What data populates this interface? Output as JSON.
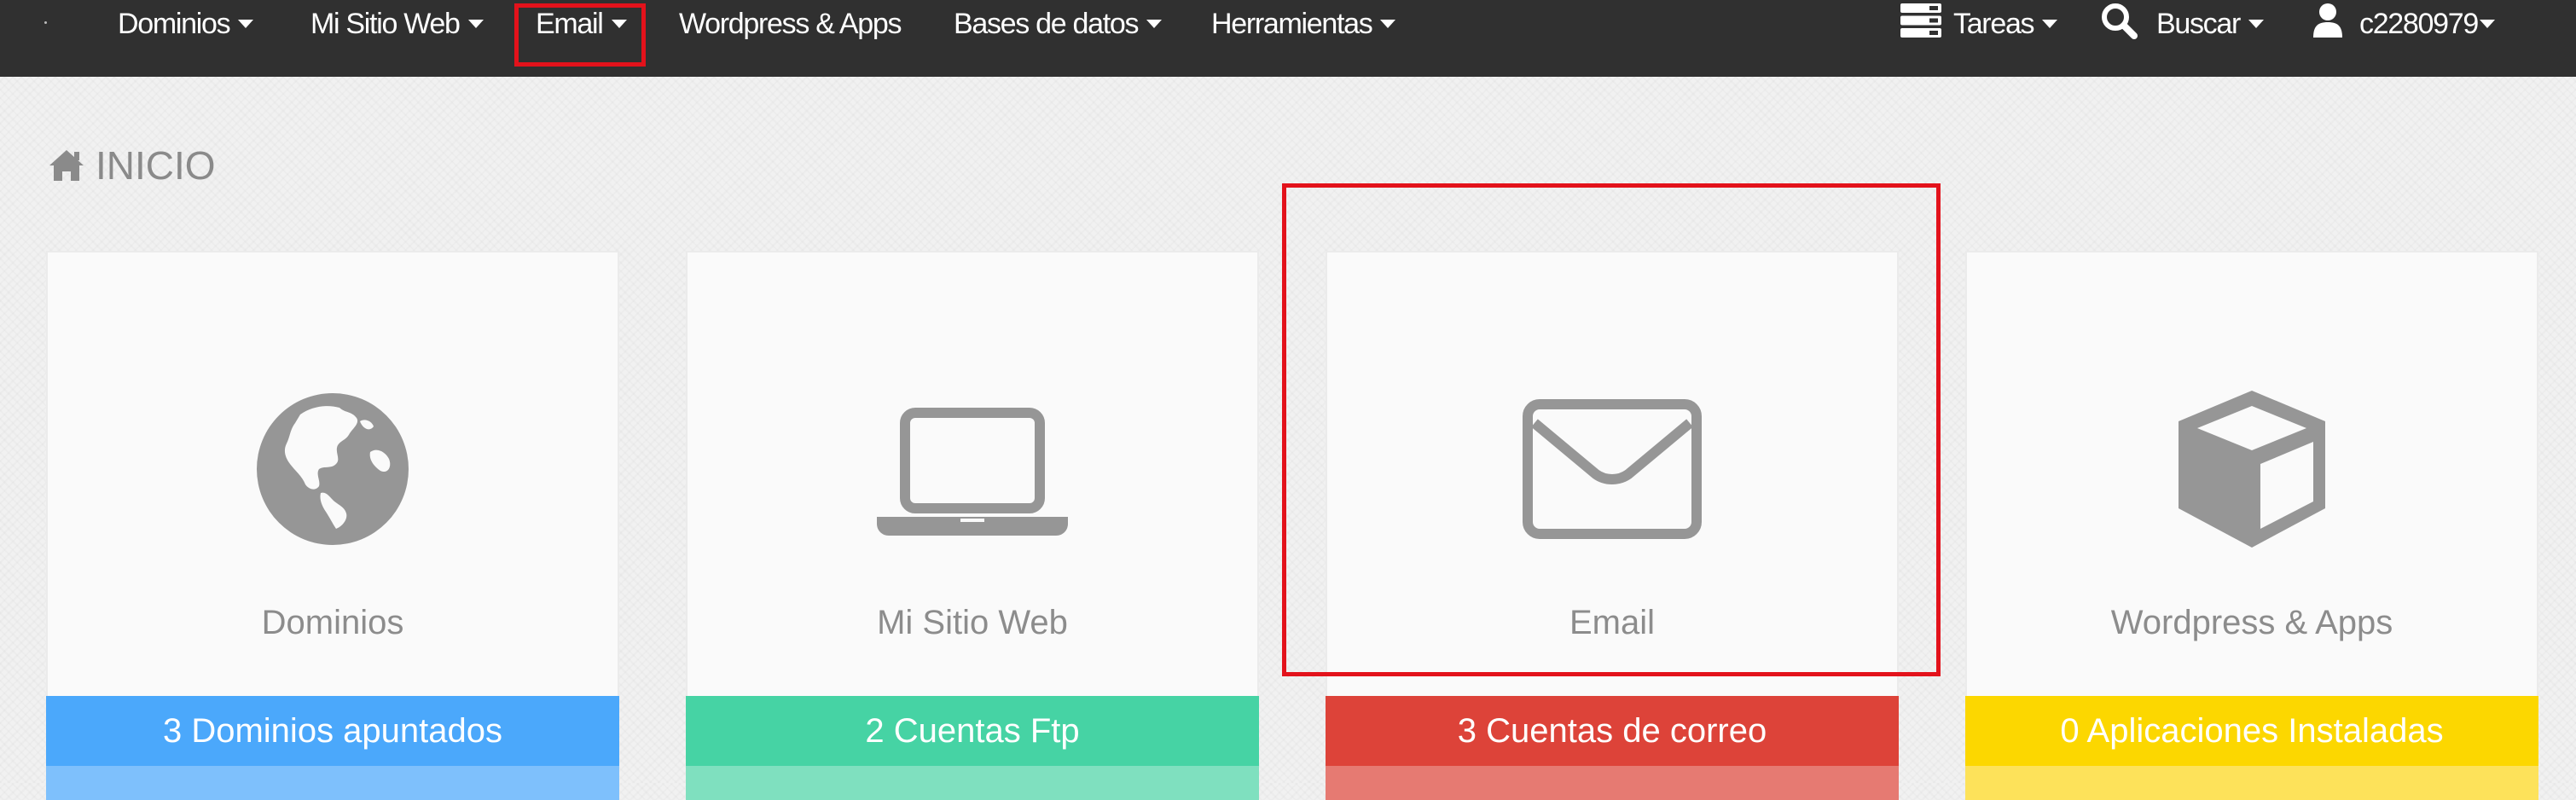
{
  "nav": {
    "items": [
      {
        "label": "Dominios"
      },
      {
        "label": "Mi Sitio Web"
      },
      {
        "label": "Email"
      },
      {
        "label": "Wordpress & Apps"
      },
      {
        "label": "Bases de datos"
      },
      {
        "label": "Herramientas"
      }
    ],
    "tasks_label": "Tareas",
    "search_label": "Buscar",
    "user_label": "c2280979"
  },
  "page": {
    "title": "INICIO",
    "title_icon": "home-icon"
  },
  "cards": [
    {
      "label": "Dominios",
      "icon": "globe-icon",
      "footer": "3 Dominios apuntados",
      "color": "#4ba8fb",
      "color_light": "#7ec0fc"
    },
    {
      "label": "Mi Sitio Web",
      "icon": "laptop-icon",
      "footer": "2 Cuentas Ftp",
      "color": "#46d3a4",
      "color_light": "#7fe0bf"
    },
    {
      "label": "Email",
      "icon": "envelope-icon",
      "footer": "3 Cuentas de correo",
      "color": "#dd4339",
      "color_light": "#e67a72"
    },
    {
      "label": "Wordpress & Apps",
      "icon": "cube-icon",
      "footer": "0 Aplicaciones Instaladas",
      "color": "#fcd700",
      "color_light": "#fde25a"
    }
  ],
  "colors": {
    "nav_bg": "#303030",
    "highlight": "#e3121b",
    "icon_gray": "#969696"
  }
}
